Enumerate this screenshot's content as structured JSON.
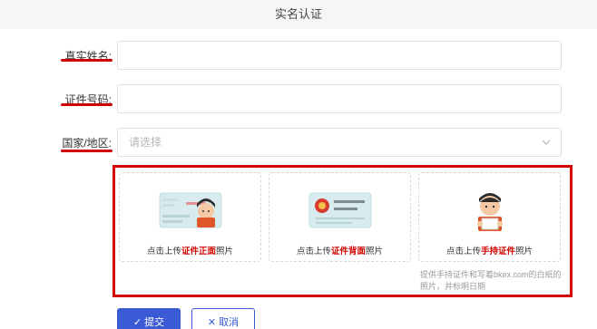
{
  "header": {
    "title": "实名认证"
  },
  "form": {
    "name": {
      "label": "真实姓名:",
      "value": ""
    },
    "id_number": {
      "label": "证件号码:",
      "value": ""
    },
    "region": {
      "label": "国家/地区:",
      "placeholder": "请选择"
    }
  },
  "uploads": [
    {
      "caption_prefix": "点击上传",
      "caption_emphasis": "证件正面",
      "caption_suffix": "照片",
      "icon": "id-card-front-icon"
    },
    {
      "caption_prefix": "点击上传",
      "caption_emphasis": "证件背面",
      "caption_suffix": "照片",
      "icon": "id-card-back-icon"
    },
    {
      "caption_prefix": "点击上传",
      "caption_emphasis": "手持证件",
      "caption_suffix": "照片",
      "icon": "hand-holding-id-icon"
    }
  ],
  "hint": "提供手持证件和写着bkex.com的白纸的照片，并标明日期",
  "buttons": {
    "submit": "提交",
    "cancel": "取消"
  },
  "colors": {
    "accent": "#3b5bd6",
    "highlight": "#d40000"
  }
}
